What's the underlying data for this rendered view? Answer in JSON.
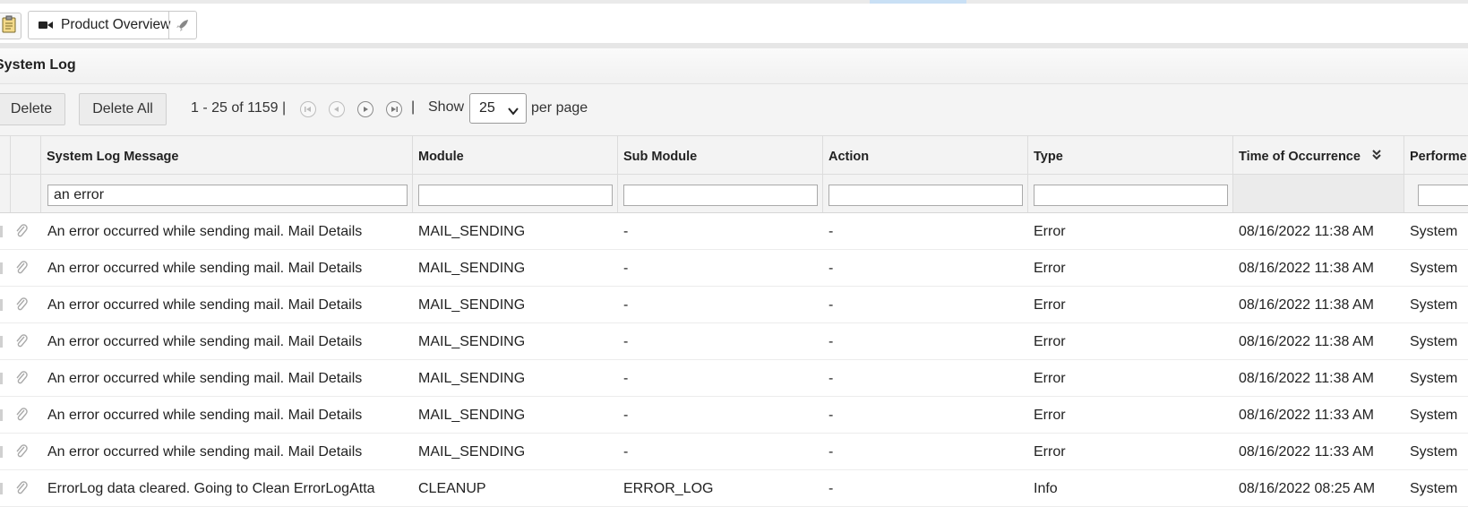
{
  "tabs": {
    "product_overview_label": "Product Overview"
  },
  "panel": {
    "title": "System Log"
  },
  "actions": {
    "delete_label": "Delete",
    "delete_all_label": "Delete All",
    "paging_text": "1 - 25 of 1159 |",
    "pipe": "|",
    "show_label": "Show",
    "per_page_value": "25",
    "per_page_label": "per page"
  },
  "columns": {
    "message": "System Log Message",
    "module": "Module",
    "submodule": "Sub Module",
    "action": "Action",
    "type": "Type",
    "time": "Time of Occurrence",
    "performed": "Performe"
  },
  "filters": {
    "message_value": "an error"
  },
  "rows": [
    {
      "message": "An error occurred while sending mail. Mail Details",
      "module": "MAIL_SENDING",
      "submodule": "-",
      "action": "-",
      "type": "Error",
      "time": "08/16/2022 11:38 AM",
      "performed": "System"
    },
    {
      "message": "An error occurred while sending mail. Mail Details",
      "module": "MAIL_SENDING",
      "submodule": "-",
      "action": "-",
      "type": "Error",
      "time": "08/16/2022 11:38 AM",
      "performed": "System"
    },
    {
      "message": "An error occurred while sending mail. Mail Details",
      "module": "MAIL_SENDING",
      "submodule": "-",
      "action": "-",
      "type": "Error",
      "time": "08/16/2022 11:38 AM",
      "performed": "System"
    },
    {
      "message": "An error occurred while sending mail. Mail Details",
      "module": "MAIL_SENDING",
      "submodule": "-",
      "action": "-",
      "type": "Error",
      "time": "08/16/2022 11:38 AM",
      "performed": "System"
    },
    {
      "message": "An error occurred while sending mail. Mail Details",
      "module": "MAIL_SENDING",
      "submodule": "-",
      "action": "-",
      "type": "Error",
      "time": "08/16/2022 11:38 AM",
      "performed": "System"
    },
    {
      "message": "An error occurred while sending mail. Mail Details",
      "module": "MAIL_SENDING",
      "submodule": "-",
      "action": "-",
      "type": "Error",
      "time": "08/16/2022 11:33 AM",
      "performed": "System"
    },
    {
      "message": "An error occurred while sending mail. Mail Details",
      "module": "MAIL_SENDING",
      "submodule": "-",
      "action": "-",
      "type": "Error",
      "time": "08/16/2022 11:33 AM",
      "performed": "System"
    },
    {
      "message": "ErrorLog data cleared. Going to Clean ErrorLogAtta",
      "module": "CLEANUP",
      "submodule": "ERROR_LOG",
      "action": "-",
      "type": "Info",
      "time": "08/16/2022 08:25 AM",
      "performed": "System"
    }
  ]
}
